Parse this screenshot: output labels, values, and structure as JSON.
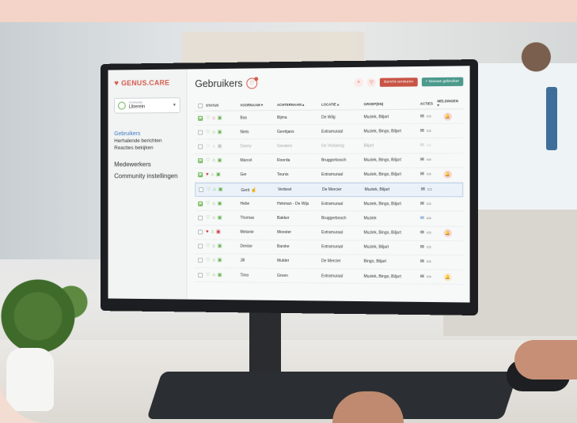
{
  "app": {
    "logo_text": "GENUS.CARE"
  },
  "sidebar": {
    "community_label": "Community",
    "community_value": "Liberein",
    "items": [
      {
        "label": "Gebruikers",
        "active": true
      },
      {
        "label": "Herhalende berichten"
      },
      {
        "label": "Reacties bekijken"
      },
      {
        "label": "Medewerkers"
      },
      {
        "label": "Community instellingen"
      }
    ]
  },
  "header": {
    "title": "Gebruikers",
    "send_button": "Bericht versturen",
    "new_user_button": "+ Nieuwe gebruiker"
  },
  "table": {
    "columns": {
      "status": "STATUS",
      "first": "VOORNAAM ▾",
      "last": "ACHTERNAAM ▴",
      "location": "LOCATIE ▴",
      "group": "GROEP(EN)",
      "actions": "ACTIES",
      "notifications": "MELDINGEN ▾"
    },
    "rows": [
      {
        "first": "Bas",
        "last": "Bijma",
        "location": "De Wilg",
        "group": "Muziek, Biljart",
        "checked": true,
        "heart": false,
        "home": true,
        "img": false,
        "bell": "red"
      },
      {
        "first": "Niels",
        "last": "Gerritjans",
        "location": "Extramuraal",
        "group": "Muziek, Bingo, Biljart",
        "checked": false,
        "heart": false,
        "home": false,
        "img": false,
        "bell": ""
      },
      {
        "first": "Danny",
        "last": "Gresters",
        "location": "De Vlotsteeg",
        "group": "Biljart",
        "checked": false,
        "dim": true,
        "bell": ""
      },
      {
        "first": "Marcel",
        "last": "Roorda",
        "location": "Bruggerbosch",
        "group": "Muziek, Bingo, Biljart",
        "checked": true,
        "heart": false,
        "home": false,
        "img": false,
        "bell": ""
      },
      {
        "first": "Ger",
        "last": "Teunis",
        "location": "Extramuraal",
        "group": "Muziek, Bingo, Biljart",
        "checked": true,
        "heart": true,
        "home": false,
        "img": false,
        "bell": "red"
      },
      {
        "first": "Gerit",
        "last": "Verbeet",
        "location": "De Mercier",
        "group": "Muziek, Biljart",
        "checked": false,
        "highlight": true,
        "bell": ""
      },
      {
        "first": "Hebe",
        "last": "Hekman - De Wijs",
        "location": "Extramuraal",
        "group": "Muziek, Bingo, Biljart",
        "checked": true,
        "bell": ""
      },
      {
        "first": "Thomas",
        "last": "Bakker",
        "location": "Bruggerbosch",
        "group": "Muziek",
        "checked": false,
        "action_blue": true,
        "bell": ""
      },
      {
        "first": "Melanie",
        "last": "Meester",
        "location": "Extramuraal",
        "group": "Muziek, Bingo, Biljart",
        "checked": false,
        "heart": true,
        "home": false,
        "img": true,
        "bell": "red"
      },
      {
        "first": "Denise",
        "last": "Barske",
        "location": "Extramuraal",
        "group": "Muziek, Biljart",
        "checked": false,
        "bell": ""
      },
      {
        "first": "Jill",
        "last": "Mulder",
        "location": "De Mercier",
        "group": "Bingo, Biljart",
        "checked": false,
        "bell": ""
      },
      {
        "first": "Timo",
        "last": "Groen",
        "location": "Extramuraal",
        "group": "Muziek, Bingo, Biljart",
        "checked": false,
        "bell": "yellow"
      }
    ]
  },
  "colors": {
    "brand": "#d65a4c",
    "accent_green": "#62b04a",
    "accent_teal": "#4c9a8c",
    "link_blue": "#3b78c2"
  },
  "icons": [
    "heart-icon",
    "home-icon",
    "image-icon",
    "mail-icon",
    "message-icon",
    "bell-icon",
    "search-icon",
    "filter-icon"
  ]
}
